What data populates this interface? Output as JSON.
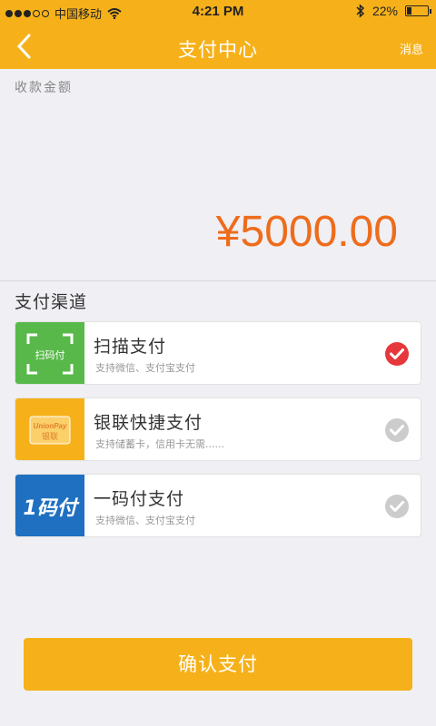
{
  "status_bar": {
    "carrier": "中国移动",
    "time": "4:21 PM",
    "battery_percent": "22%",
    "battery_level": 0.22,
    "signal_bars_on": 3,
    "signal_bars_total": 5
  },
  "navbar": {
    "title": "支付中心",
    "right_label": "消息"
  },
  "amount": {
    "label": "收款金额",
    "value": "¥5000.00"
  },
  "channels": {
    "title": "支付渠道",
    "items": [
      {
        "name": "扫描支付",
        "desc": "支持微信、支付宝支付",
        "logo_text": "扫码付",
        "selected": true
      },
      {
        "name": "银联快捷支付",
        "desc": "支持储蓄卡，信用卡无需......",
        "logo_text": "UnionPay",
        "logo_subtext": "银联",
        "selected": false
      },
      {
        "name": "一码付支付",
        "desc": "支持微信、支付宝支付",
        "logo_text": "1码付",
        "selected": false
      }
    ]
  },
  "confirm_button": "确认支付",
  "colors": {
    "primary": "#f6b11a",
    "amount": "#ee6c1b",
    "scan_green": "#58b94a",
    "ym_blue": "#1f70c1",
    "check_selected": "#e5373c",
    "check_unselected": "#cccccc"
  }
}
